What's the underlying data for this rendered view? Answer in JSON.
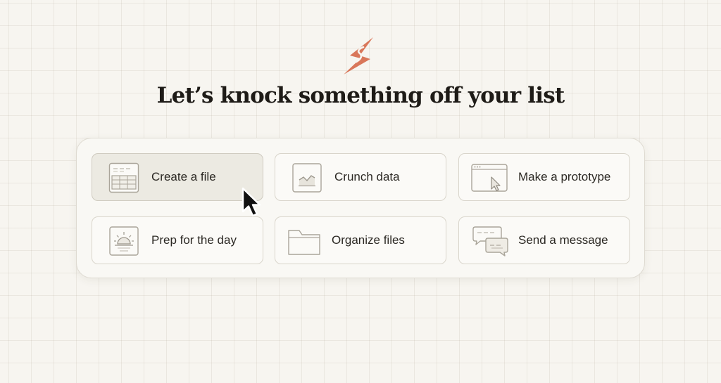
{
  "header": {
    "logo_icon": "lightning-bolt-icon",
    "accent_color": "#d9775a",
    "title": "Let’s knock something off your list"
  },
  "actions": [
    {
      "label": "Create a file",
      "icon": "spreadsheet-icon",
      "selected": true
    },
    {
      "label": "Crunch data",
      "icon": "chart-icon",
      "selected": false
    },
    {
      "label": "Make a prototype",
      "icon": "browser-window-icon",
      "selected": false
    },
    {
      "label": "Prep for the day",
      "icon": "sunrise-icon",
      "selected": false
    },
    {
      "label": "Organize files",
      "icon": "folder-icon",
      "selected": false
    },
    {
      "label": "Send a message",
      "icon": "chat-bubbles-icon",
      "selected": false
    }
  ],
  "pointer": {
    "icon": "mouse-pointer-icon"
  }
}
